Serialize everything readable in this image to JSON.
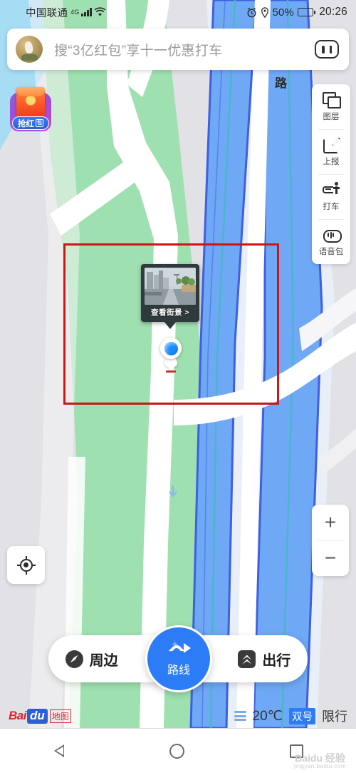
{
  "status_bar": {
    "carrier": "中国联通",
    "network": "4G",
    "signal_icon": "signal-bars-icon",
    "wifi_icon": "wifi-icon",
    "alarm_icon": "alarm-clock-icon",
    "location_icon": "location-pin-icon",
    "battery_percent": "50%",
    "battery_icon": "battery-icon",
    "time": "20:26"
  },
  "search": {
    "avatar_icon": "user-avatar",
    "placeholder": "搜“3亿红包”享十一优惠打车",
    "right_icon": "baidu-bear-paw-icon"
  },
  "red_packet": {
    "label": "抢红",
    "badge": "包",
    "icon": "red-envelope-icon"
  },
  "tool_panel": [
    {
      "icon": "layers-icon",
      "label": "图层"
    },
    {
      "icon": "report-pencil-icon",
      "label": "上报"
    },
    {
      "icon": "taxi-icon",
      "label": "打车"
    },
    {
      "icon": "voice-package-icon",
      "label": "语音包"
    }
  ],
  "map": {
    "road_label": "路",
    "locate_icon": "crosshair-locate-icon",
    "zoom_in": "+",
    "zoom_out": "−",
    "location_marker_icon": "current-location-dot",
    "pin_icon": "map-pin-icon",
    "colors": {
      "park_green": "#9fe0b0",
      "highway_blue": "#6fa8f5",
      "highway_border": "#3f5fe0",
      "road_white": "#ffffff",
      "land_grey": "#e2e2e6",
      "water_blue": "#9fd5f2",
      "annotation_red": "#cc1515",
      "accent_blue": "#2b7cf6"
    }
  },
  "street_view": {
    "label": "查看街景 >",
    "thumb_icon": "street-view-thumbnail"
  },
  "annotation": {
    "shape": "rectangle",
    "color": "#cc1515"
  },
  "action_bar": {
    "nearby": {
      "label": "周边",
      "icon": "compass-icon"
    },
    "route": {
      "label": "路线",
      "icon": "route-arrow-icon"
    },
    "travel": {
      "label": "出行",
      "icon": "chevrons-up-icon"
    }
  },
  "info_strip": {
    "logo_bai": "Bai",
    "logo_du": "du",
    "logo_map": "地图",
    "traffic_icon": "traffic-layers-icon",
    "temperature": "20℃",
    "limit_badge": "双号",
    "limit_text": "限行"
  },
  "nav_bar": {
    "back": "back-triangle-icon",
    "home": "home-circle-icon",
    "recent": "recent-square-icon"
  },
  "watermark": {
    "line1": "Baidu 经验",
    "line2": "jingyan.baidu.com"
  }
}
